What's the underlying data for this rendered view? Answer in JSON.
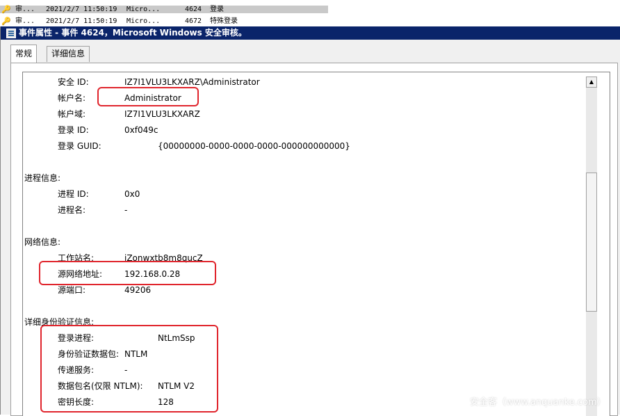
{
  "event_list": [
    {
      "source": "审...",
      "date": "2021/2/7 11:50:19",
      "provider": "Micro...",
      "id": "4624",
      "task": "登录",
      "selected": true
    },
    {
      "source": "审...",
      "date": "2021/2/7 11:50:19",
      "provider": "Micro...",
      "id": "4672",
      "task": "特殊登录",
      "selected": false
    }
  ],
  "dialog": {
    "title": "事件属性 - 事件 4624，Microsoft Windows 安全审核。",
    "tabs": [
      "常规",
      "详细信息"
    ]
  },
  "details": {
    "rows": [
      {
        "label": "安全 ID:",
        "value": "IZ7I1VLU3LKXARZ\\Administrator"
      },
      {
        "label": "帐户名:",
        "value": "Administrator"
      },
      {
        "label": "帐户域:",
        "value": "IZ7I1VLU3LKXARZ"
      },
      {
        "label": "登录 ID:",
        "value": "0xf049c"
      },
      {
        "label": "登录 GUID:",
        "value": "{00000000-0000-0000-0000-000000000000}"
      }
    ],
    "process_header": "进程信息:",
    "process_rows": [
      {
        "label": "进程 ID:",
        "value": "0x0"
      },
      {
        "label": "进程名:",
        "value": "-"
      }
    ],
    "network_header": "网络信息:",
    "network_rows": [
      {
        "label": "工作站名:",
        "value": "iZonwxtb8m8qucZ"
      },
      {
        "label": "源网络地址:",
        "value": "192.168.0.28"
      },
      {
        "label": "源端口:",
        "value": "49206"
      }
    ],
    "auth_header": "详细身份验证信息:",
    "auth_rows": [
      {
        "label": "登录进程:",
        "value": "NtLmSsp"
      },
      {
        "label": "身份验证数据包:",
        "value": "NTLM"
      },
      {
        "label": "传递服务:",
        "value": "-"
      },
      {
        "label": "数据包名(仅限 NTLM):",
        "value": "NTLM V2"
      },
      {
        "label": "密钥长度:",
        "value": "128"
      }
    ]
  },
  "scrollbar": {
    "up": "▲",
    "down": "▼"
  },
  "watermark": "安全客（www.anquanke.com）",
  "colors": {
    "highlight": "#e0242c",
    "titlebar": "#0a246a"
  }
}
